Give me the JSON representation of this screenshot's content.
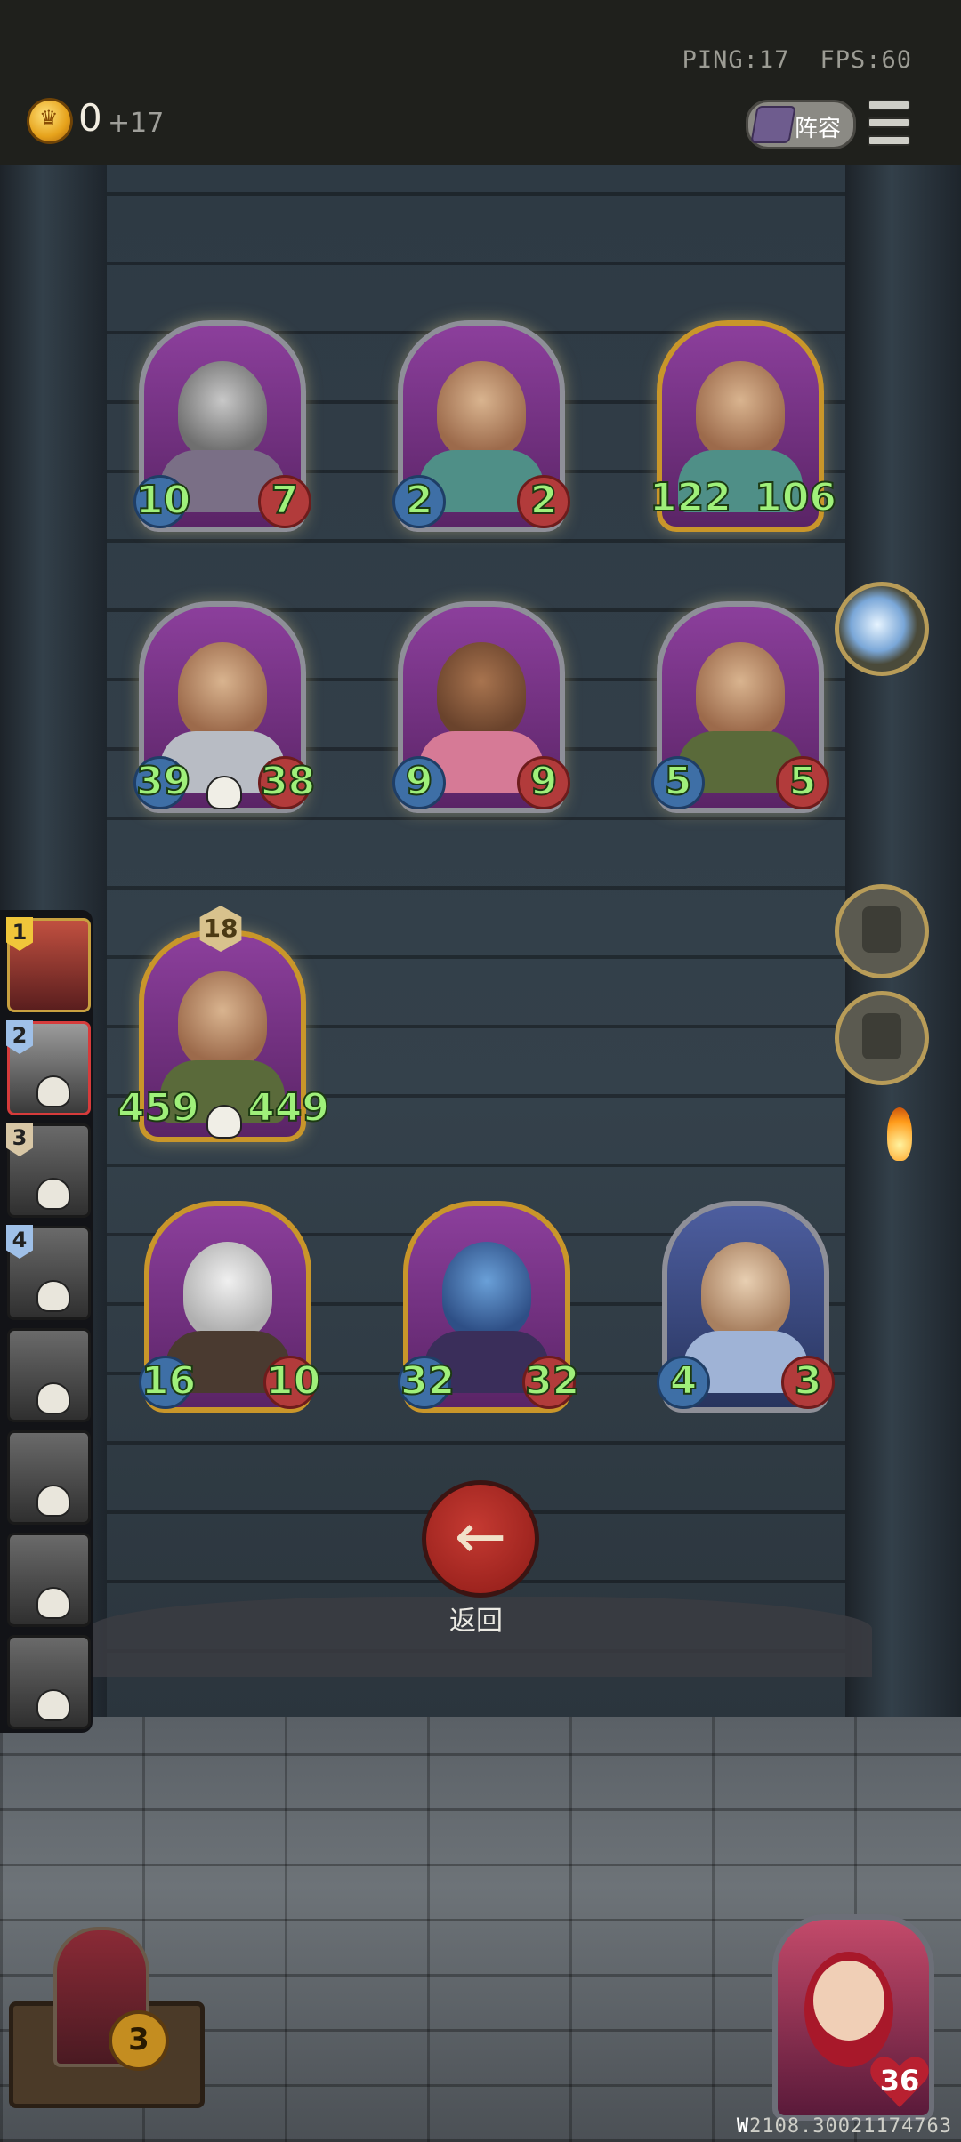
{
  "status": {
    "ping": "PING:17",
    "fps": "FPS:60"
  },
  "economy": {
    "gold": "0",
    "income": "+17"
  },
  "lineup_button": {
    "label": "阵容"
  },
  "board": {
    "row1": [
      {
        "atk": "10",
        "hp": "7"
      },
      {
        "atk": "2",
        "hp": "2"
      },
      {
        "atk": "122",
        "hp": "106"
      }
    ],
    "row2": [
      {
        "atk": "39",
        "hp": "38"
      },
      {
        "atk": "9",
        "hp": "9"
      },
      {
        "atk": "5",
        "hp": "5"
      }
    ],
    "row3": [
      {
        "tier": "18",
        "atk": "459",
        "hp": "449"
      }
    ],
    "row4": [
      {
        "atk": "16",
        "hp": "10"
      },
      {
        "atk": "32",
        "hp": "32"
      },
      {
        "atk": "4",
        "hp": "3"
      }
    ]
  },
  "players": {
    "ranks": [
      "1",
      "2",
      "3",
      "4"
    ]
  },
  "back_button": {
    "icon": "arrow-left-icon",
    "label": "返回"
  },
  "hero": {
    "left_badge": "3",
    "health": "36"
  },
  "footer": {
    "id_prefix": "W",
    "id": "2108.30021174763"
  }
}
